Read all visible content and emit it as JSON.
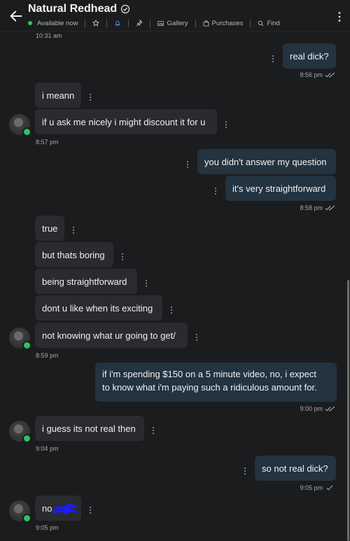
{
  "header": {
    "title": "Natural Redhead",
    "status": "Available now",
    "menu": {
      "gallery": "Gallery",
      "purchases": "Purchases",
      "find": "Find"
    }
  },
  "top_time": "10:31 am",
  "messages": [
    {
      "text": "real dick?"
    },
    {
      "time": "8:56 pm"
    },
    {
      "text": "i meann"
    },
    {
      "text": "if u ask me nicely i might discount it for u"
    },
    {
      "time": "8:57 pm"
    },
    {
      "text": "you didn't answer my question"
    },
    {
      "text": "it's very straightforward"
    },
    {
      "time": "8:58 pm"
    },
    {
      "text": "true"
    },
    {
      "text": "but thats boring"
    },
    {
      "text": "being straightforward"
    },
    {
      "text": "dont u like when its exciting"
    },
    {
      "text": "not knowing what ur going to get/"
    },
    {
      "time": "8:59 pm"
    },
    {
      "text_line1": "if i'm spending $150 on a 5 minute video, no, i expect",
      "text_line2": "to know what i'm paying such a ridiculous amount for."
    },
    {
      "time": "9:00 pm"
    },
    {
      "text": "i guess its not real then"
    },
    {
      "time": "9:04 pm"
    },
    {
      "text": "so not real dick?"
    },
    {
      "time": "9:05 pm"
    },
    {
      "text": "no"
    },
    {
      "time": "9:05 pm"
    }
  ],
  "colors": {
    "background": "#1b1c1e",
    "incoming_bubble": "#2a2b2e",
    "outgoing_bubble": "#23333f",
    "online": "#2ec25a",
    "scribble": "#1b1bff"
  }
}
